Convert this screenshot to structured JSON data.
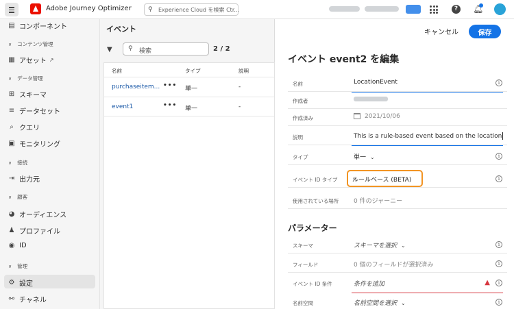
{
  "topbar": {
    "app_title": "Adobe Journey Optimizer",
    "search_placeholder": "Experience Cloud を検索 Ctr..."
  },
  "sidebar": {
    "items": [
      {
        "kind": "item",
        "label": "コンポーネント",
        "icon": "components-icon"
      },
      {
        "kind": "section",
        "label": "コンテンツ管理"
      },
      {
        "kind": "item",
        "label": "アセット",
        "icon": "assets-icon",
        "external": true
      },
      {
        "kind": "section",
        "label": "データ管理"
      },
      {
        "kind": "item",
        "label": "スキーマ",
        "icon": "schema-icon"
      },
      {
        "kind": "item",
        "label": "データセット",
        "icon": "dataset-icon"
      },
      {
        "kind": "item",
        "label": "クエリ",
        "icon": "query-icon"
      },
      {
        "kind": "item",
        "label": "モニタリング",
        "icon": "monitoring-icon"
      },
      {
        "kind": "section",
        "label": "接続"
      },
      {
        "kind": "item",
        "label": "出力元",
        "icon": "sources-icon"
      },
      {
        "kind": "section",
        "label": "顧客"
      },
      {
        "kind": "item",
        "label": "オーディエンス",
        "icon": "audiences-icon"
      },
      {
        "kind": "item",
        "label": "プロファイル",
        "icon": "profiles-icon"
      },
      {
        "kind": "item",
        "label": "ID",
        "icon": "identity-icon"
      },
      {
        "kind": "section",
        "label": "管理"
      },
      {
        "kind": "item",
        "label": "設定",
        "icon": "settings-icon",
        "active": true
      },
      {
        "kind": "item",
        "label": "チャネル",
        "icon": "channels-icon"
      }
    ]
  },
  "events_panel": {
    "title": "イベント",
    "search_placeholder": "検索",
    "count": "2 / 2",
    "columns": [
      "名前",
      "タイプ",
      "説明"
    ],
    "rows": [
      {
        "name": "purchaseitem...",
        "more": "•••",
        "type": "単一",
        "description": "-"
      },
      {
        "name": "event1",
        "more": "•••",
        "type": "単一",
        "description": "-"
      }
    ]
  },
  "editor": {
    "cancel_label": "キャンセル",
    "save_label": "保存",
    "title": "イベント event2 を編集",
    "fields": {
      "name": {
        "label": "名前",
        "value": "LocationEvent"
      },
      "created_by": {
        "label": "作成者"
      },
      "created_at": {
        "label": "作成済み",
        "value": "2021/10/06"
      },
      "description": {
        "label": "説明",
        "value": "This is a rule-based event based on the location"
      },
      "type": {
        "label": "タイプ",
        "value": "単一"
      },
      "event_id_type": {
        "label": "イベント ID タイプ",
        "value": "ルールベース (BETA)"
      },
      "used_in": {
        "label": "使用されている場所",
        "value": "0 件のジャーニー"
      }
    },
    "parameters_title": "パラメーター",
    "parameters": {
      "schema": {
        "label": "スキーマ",
        "value": "スキーマを選択"
      },
      "fields": {
        "label": "フィールド",
        "value": "0 個のフィールドが選択済み"
      },
      "event_id_condition": {
        "label": "イベント ID 条件",
        "value": "条件を追加"
      },
      "namespace": {
        "label": "名前空間",
        "value": "名前空間を選択"
      }
    }
  },
  "colors": {
    "accent": "#1473e6",
    "highlight": "#f29423",
    "error": "#d7373f",
    "brand": "#eb1000"
  }
}
